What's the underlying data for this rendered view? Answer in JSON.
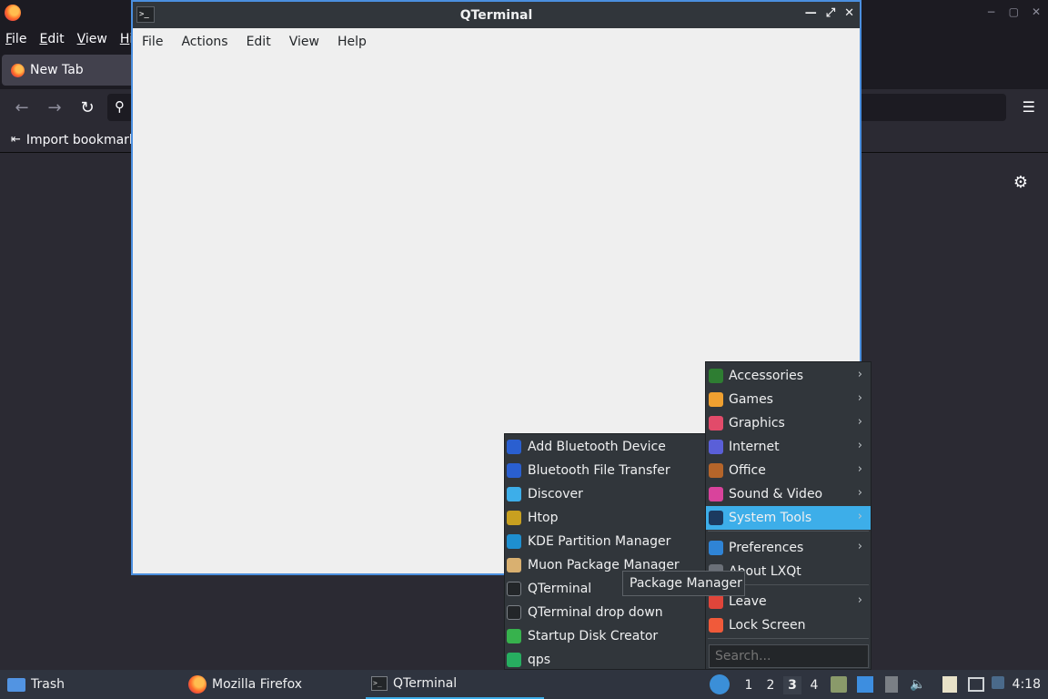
{
  "firefox": {
    "menus": [
      "File",
      "Edit",
      "View",
      "Hi"
    ],
    "tab_label": "New Tab",
    "bookmark_label": "Import bookmark"
  },
  "qterminal": {
    "title": "QTerminal",
    "menus": [
      "File",
      "Actions",
      "Edit",
      "View",
      "Help"
    ]
  },
  "main_menu": {
    "items": [
      {
        "label": "Accessories",
        "icon": "accessories-icon",
        "color": "#2e7d32",
        "submenu": true
      },
      {
        "label": "Games",
        "icon": "gamepad-icon",
        "color": "#f0a030",
        "submenu": true
      },
      {
        "label": "Graphics",
        "icon": "graphics-icon",
        "color": "#e24b6a",
        "submenu": true
      },
      {
        "label": "Internet",
        "icon": "internet-icon",
        "color": "#5a5fd8",
        "submenu": true
      },
      {
        "label": "Office",
        "icon": "briefcase-icon",
        "color": "#b5652a",
        "submenu": true
      },
      {
        "label": "Sound & Video",
        "icon": "multimedia-icon",
        "color": "#d9439c",
        "submenu": true
      },
      {
        "label": "System Tools",
        "icon": "system-tools-icon",
        "color": "#1c3a5f",
        "submenu": true,
        "active": true
      },
      {
        "label": "Preferences",
        "icon": "preferences-icon",
        "color": "#2f84d6",
        "submenu": true
      },
      {
        "label": "About LXQt",
        "icon": "about-icon",
        "color": "#6b7078",
        "submenu": false
      },
      {
        "label": "Leave",
        "icon": "power-icon",
        "color": "#e0453a",
        "submenu": true
      },
      {
        "label": "Lock Screen",
        "icon": "lock-icon",
        "color": "#f05a3a",
        "submenu": false
      }
    ],
    "search_placeholder": "Search..."
  },
  "system_tools": {
    "items": [
      {
        "label": "Add Bluetooth Device",
        "icon": "bluetooth-icon",
        "color": "#2a5fd0"
      },
      {
        "label": "Bluetooth File Transfer",
        "icon": "bluetooth-icon",
        "color": "#2a5fd0"
      },
      {
        "label": "Discover",
        "icon": "discover-icon",
        "color": "#3daee9"
      },
      {
        "label": "Htop",
        "icon": "htop-icon",
        "color": "#c8a020"
      },
      {
        "label": "KDE Partition Manager",
        "icon": "partition-icon",
        "color": "#1e8fd0"
      },
      {
        "label": "Muon Package Manager",
        "icon": "package-icon",
        "color": "#d9b070"
      },
      {
        "label": "QTerminal",
        "icon": "terminal-icon",
        "color": "#232629"
      },
      {
        "label": "QTerminal drop down",
        "icon": "terminal-icon",
        "color": "#232629"
      },
      {
        "label": "Startup Disk Creator",
        "icon": "disk-creator-icon",
        "color": "#37b24d"
      },
      {
        "label": "qps",
        "icon": "qps-icon",
        "color": "#27ae60"
      }
    ]
  },
  "tooltip": "Package Manager",
  "panel": {
    "tasks": [
      "Trash",
      "Mozilla Firefox",
      "QTerminal"
    ],
    "desktops": [
      "1",
      "2",
      "3",
      "4"
    ],
    "active_desktop": "3",
    "clock": "4:18"
  }
}
